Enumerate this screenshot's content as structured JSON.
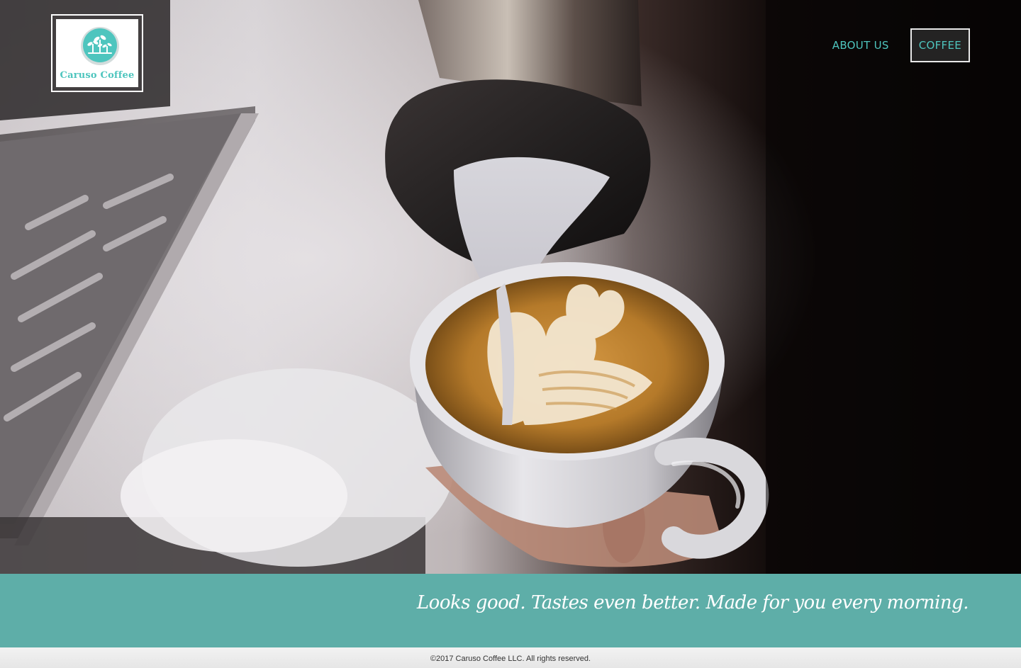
{
  "brand": {
    "name": "Caruso Coffee",
    "logo_icon": "sprouting-plants-icon",
    "accent_color": "#4ec5be"
  },
  "nav": {
    "items": [
      {
        "label": "ABOUT US",
        "active": false
      },
      {
        "label": "COFFEE",
        "active": true
      }
    ]
  },
  "hero": {
    "image": "latte-art-pour-photo"
  },
  "band": {
    "tagline": "Looks good. Tastes even better. Made for you every morning.",
    "color": "#5eaea8"
  },
  "footer": {
    "copyright": "©2017 Caruso Coffee LLC. All rights reserved."
  }
}
